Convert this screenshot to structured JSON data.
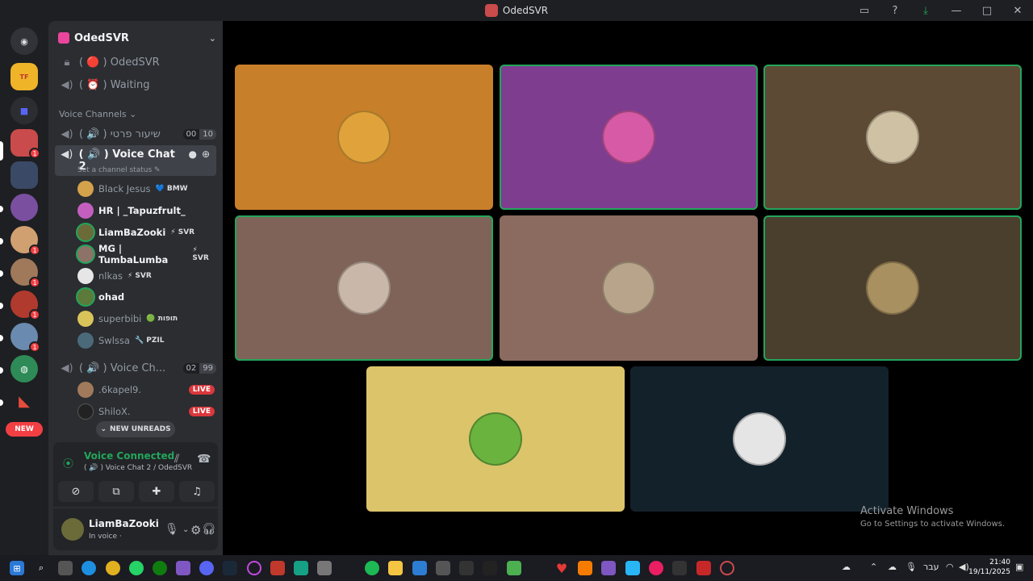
{
  "window": {
    "title": "OdedSVR",
    "controls": [
      "inbox-icon",
      "help-icon",
      "download-icon",
      "minimize",
      "maximize",
      "close"
    ]
  },
  "rail": {
    "new_label": "NEW",
    "badges": [
      "1",
      "1",
      "1",
      "1",
      "1"
    ]
  },
  "guild": {
    "name": "OdedSVR",
    "channels": [
      {
        "label": "( 🔴 ) OdedSVR",
        "icon": "lock-icon"
      },
      {
        "label": "( ⏰ ) Waiting",
        "icon": "speaker-icon"
      }
    ],
    "category": "Voice Channels",
    "voice_channels": [
      {
        "label": "( 🔊 ) שיעור פרטי",
        "counts": [
          "00",
          "10"
        ]
      },
      {
        "label": "( 🔊 ) Voice Chat 2",
        "status": "Set a channel status"
      },
      {
        "label": "( 🔊 ) Voice Ch...",
        "counts": [
          "02",
          "99"
        ]
      }
    ],
    "members_vc2": [
      {
        "name": "Black Jesus",
        "tag": "💙 BMW",
        "bright": false,
        "color": "#d4a24a"
      },
      {
        "name": "HR | _Tapuzfrult_",
        "tag": "",
        "bright": true,
        "color": "#c45fbf"
      },
      {
        "name": "LiamBaZooki",
        "tag": "⚡ SVR",
        "bright": true,
        "color": "#6b6b3a"
      },
      {
        "name": "MG | TumbaLumba",
        "tag": "⚡ SVR",
        "bright": true,
        "color": "#8d7268"
      },
      {
        "name": "nlkas",
        "tag": "⚡ SVR",
        "bright": false,
        "color": "#e6e6e6"
      },
      {
        "name": "ohad",
        "tag": "",
        "bright": true,
        "color": "#5c7a3a"
      },
      {
        "name": "superbibi",
        "tag": "🟢 תופות",
        "bright": false,
        "color": "#d9c45a"
      },
      {
        "name": "Swlssa",
        "tag": "🔧 PZIL",
        "bright": false,
        "color": "#4a6a7a"
      }
    ],
    "members_vc3": [
      {
        "name": ".6kapel9.",
        "live": "LIVE",
        "color": "#a07a5a"
      },
      {
        "name": "ShiloX.",
        "live": "LIVE",
        "color": "#222222"
      }
    ],
    "new_unreads": "NEW UNREADS"
  },
  "voice": {
    "title": "Voice Connected",
    "subtitle": "( 🔊 ) Voice Chat 2 / OdedSVR"
  },
  "user": {
    "name": "LiamBaZooki",
    "status": "In voice ·"
  },
  "stage": {
    "tiles": [
      {
        "bg": "#c87f2a",
        "face": "#e0a23a",
        "speaking": false
      },
      {
        "bg": "#7e3d8f",
        "face": "#d65aa6",
        "speaking": true
      },
      {
        "bg": "#5c4a35",
        "face": "#cfc1a3",
        "speaking": true
      },
      {
        "bg": "#7f6358",
        "face": "#c9b7a9",
        "speaking": true
      },
      {
        "bg": "#8b6b60",
        "face": "#b8a48a",
        "speaking": false
      },
      {
        "bg": "#4a3e2d",
        "face": "#a89060",
        "speaking": true
      },
      {
        "bg": "#dcc46a",
        "face": "#6bb33f",
        "speaking": false
      },
      {
        "bg": "#13212b",
        "face": "#e5e5e5",
        "speaking": false
      }
    ]
  },
  "watermark": {
    "line1": "Activate Windows",
    "line2": "Go to Settings to activate Windows."
  },
  "taskbar": {
    "lang": "עבר",
    "time": "21:40",
    "date": "19/11/2025"
  }
}
